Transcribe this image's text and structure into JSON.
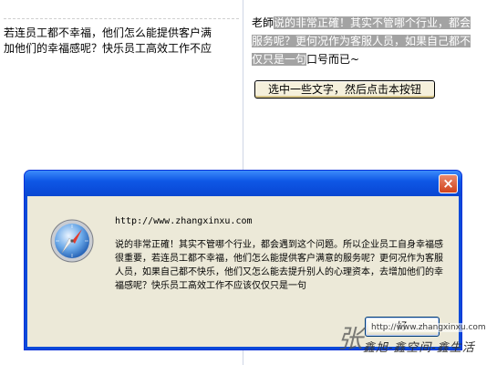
{
  "left_pane": {
    "text_line1": "若连员工都不幸福，他们怎么能提供客户满",
    "text_line2": "加他们的幸福感呢？快乐员工高效工作不应"
  },
  "right_pane": {
    "text_lead": "老師",
    "selection_line1": "说的非常正確！其实不管哪个行业，都会",
    "selection_line2": "服务呢？更何况作为客服人员，如果自己都不",
    "selection_line3_sel": "仅只是一句",
    "line3_tail": "口号而已~",
    "button_label": "选中一些文字，然后点击本按钮"
  },
  "alert": {
    "close_label": "×",
    "url": "http://www.zhangxinxu.com",
    "message": "说的非常正確！其实不管哪个行业，都会遇到这个问题。所以企业员工自身幸福感很重要，若连员工都不幸福，他们怎么能提供客户满意的服务呢？更何况作为客服人员，如果自己都不快乐，他们又怎么能去提升别人的心理资本，去增加他们的幸福感呢？快乐员工高效工作不应该仅仅只是一句",
    "ok_label": "好"
  },
  "watermark": {
    "url": "http://www.zhangxinxu.com",
    "glyph": "张",
    "name": "鑫旭-鑫空间-鑫生活"
  },
  "colors": {
    "titlebar": "#0a4bd9",
    "dialog_body": "#ece9d8",
    "selection": "#a3a3a3",
    "close_button": "#d1431b"
  }
}
